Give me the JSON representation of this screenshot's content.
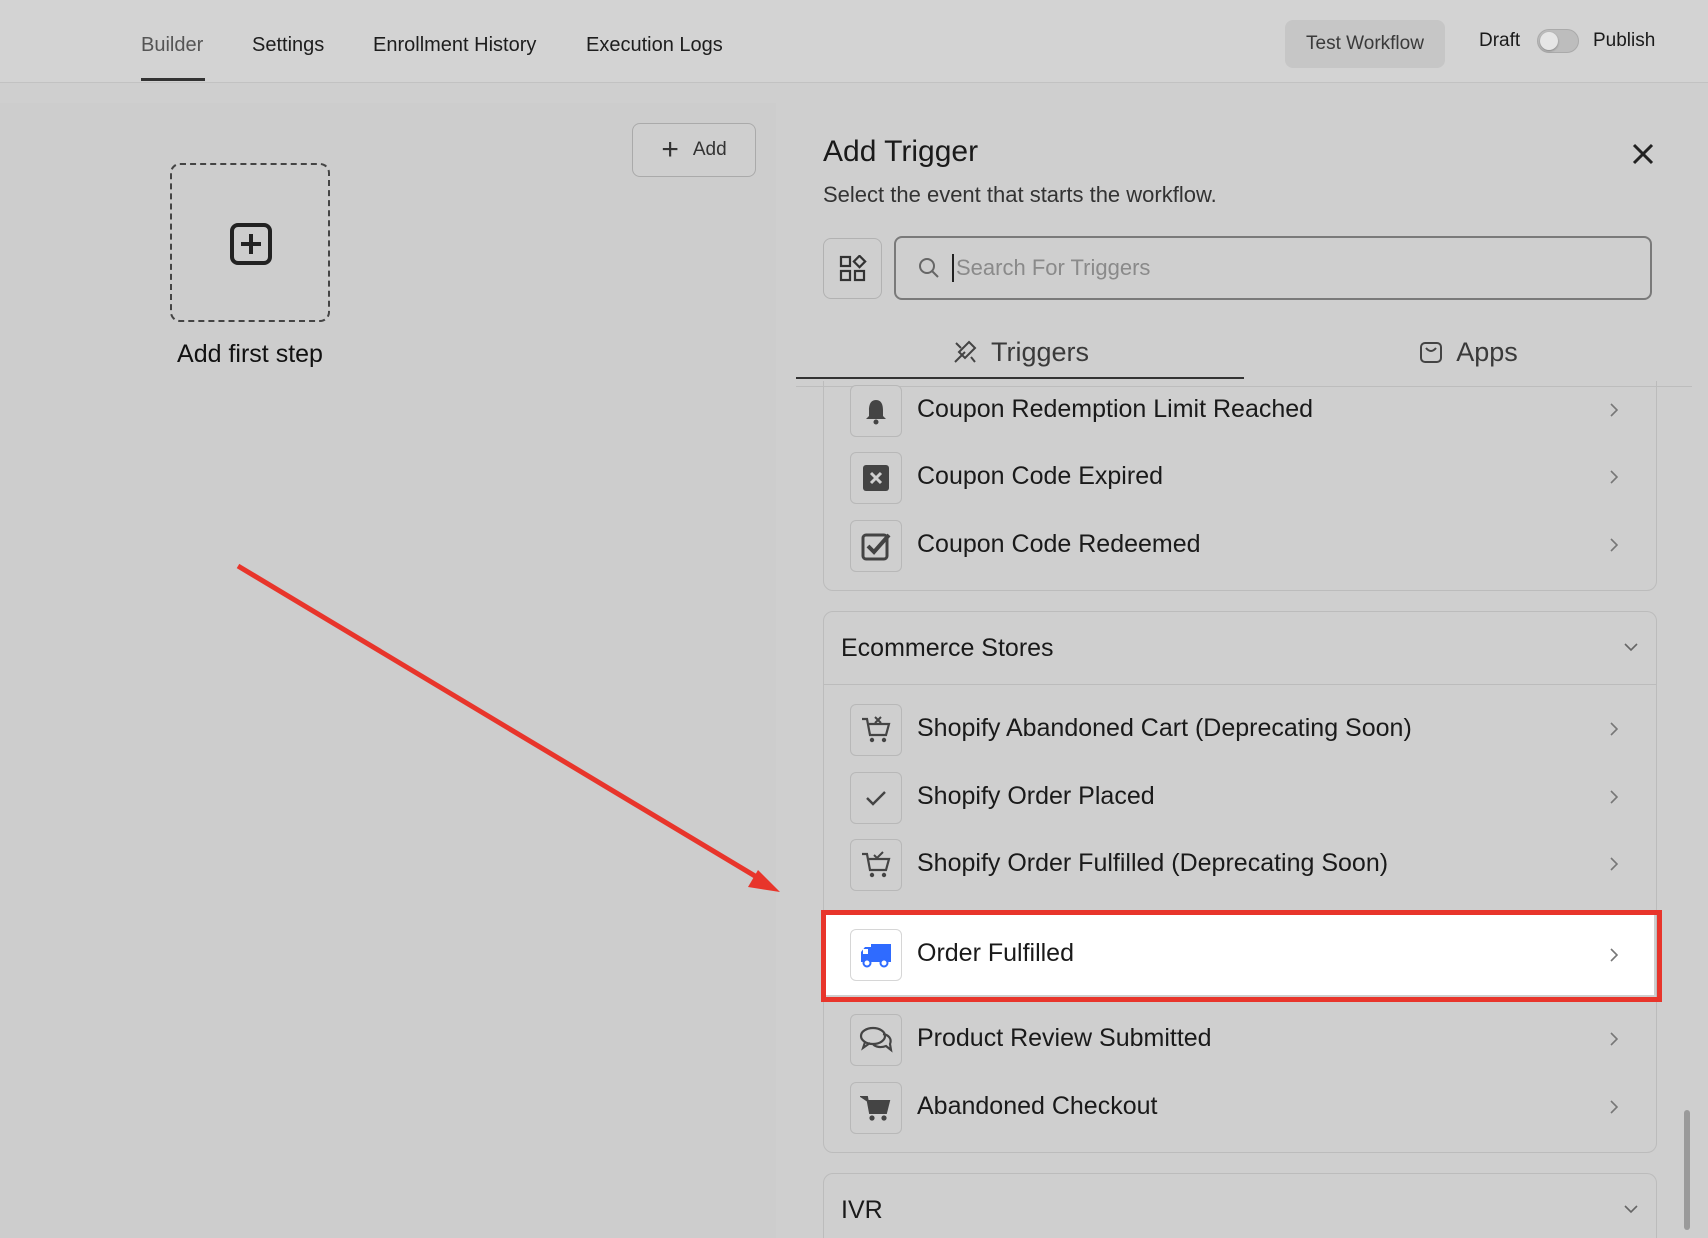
{
  "nav": {
    "tabs": [
      {
        "label": "Builder",
        "active": true
      },
      {
        "label": "Settings"
      },
      {
        "label": "Enrollment History"
      },
      {
        "label": "Execution Logs"
      }
    ],
    "test_button": "Test Workflow",
    "draft_label": "Draft",
    "publish_label": "Publish",
    "publish_toggle_on": false
  },
  "canvas": {
    "add_button": "Add",
    "first_step_label": "Add first step"
  },
  "panel": {
    "title": "Add Trigger",
    "subtitle": "Select the event that starts the workflow.",
    "search_placeholder": "Search For Triggers",
    "tabs": {
      "triggers": "Triggers",
      "apps": "Apps"
    },
    "coupon_items": [
      {
        "label": "Coupon Redemption Limit Reached",
        "icon": "bell-icon"
      },
      {
        "label": "Coupon Code Expired",
        "icon": "x-square-icon"
      },
      {
        "label": "Coupon Code Redeemed",
        "icon": "check-square-icon"
      }
    ],
    "ecommerce": {
      "title": "Ecommerce Stores",
      "items": [
        {
          "label": "Shopify Abandoned Cart (Deprecating Soon)",
          "icon": "cart-x-icon"
        },
        {
          "label": "Shopify Order Placed",
          "icon": "check-icon"
        },
        {
          "label": "Shopify Order Fulfilled (Deprecating Soon)",
          "icon": "cart-check-icon"
        },
        {
          "label": "Order Fulfilled",
          "icon": "truck-icon",
          "highlighted": true
        },
        {
          "label": "Product Review Submitted",
          "icon": "chat-bubbles-icon"
        },
        {
          "label": "Abandoned Checkout",
          "icon": "cart-icon"
        }
      ]
    },
    "ivr": {
      "title": "IVR"
    }
  },
  "colors": {
    "highlight_border": "#e8352b",
    "arrow": "#e8352b",
    "truck_icon": "#2f6bff"
  }
}
